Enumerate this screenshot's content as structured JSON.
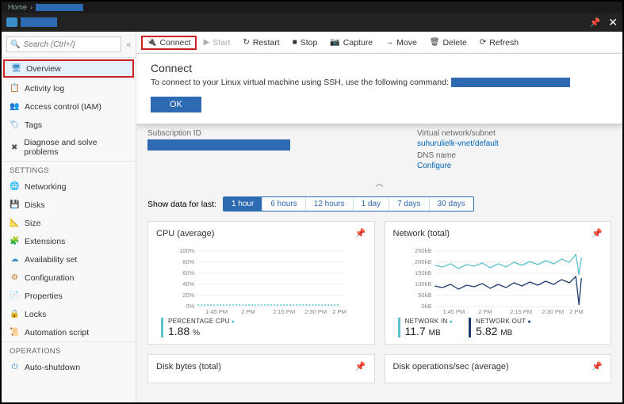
{
  "breadcrumb": {
    "home": "Home"
  },
  "search": {
    "placeholder": "Search (Ctrl+/)"
  },
  "sidebar": {
    "items": [
      {
        "label": "Overview",
        "icon": "🖥",
        "color": "#3a8dc8",
        "selected": true
      },
      {
        "label": "Activity log",
        "icon": "📋",
        "color": "#3a8dc8"
      },
      {
        "label": "Access control (IAM)",
        "icon": "👥",
        "color": "#3a8dc8"
      },
      {
        "label": "Tags",
        "icon": "🏷",
        "color": "#3a8dc8"
      },
      {
        "label": "Diagnose and solve problems",
        "icon": "✖",
        "color": "#555"
      }
    ],
    "headers": {
      "settings": "SETTINGS",
      "operations": "OPERATIONS"
    },
    "settings": [
      {
        "label": "Networking",
        "icon": "🌐",
        "color": "#e8a33d"
      },
      {
        "label": "Disks",
        "icon": "💾",
        "color": "#3a8dc8"
      },
      {
        "label": "Size",
        "icon": "📐",
        "color": "#3a8dc8"
      },
      {
        "label": "Extensions",
        "icon": "🧩",
        "color": "#3a8dc8"
      },
      {
        "label": "Availability set",
        "icon": "☁",
        "color": "#3a8dc8"
      },
      {
        "label": "Configuration",
        "icon": "⚙",
        "color": "#c97a2e"
      },
      {
        "label": "Properties",
        "icon": "📄",
        "color": "#3a8dc8"
      },
      {
        "label": "Locks",
        "icon": "🔒",
        "color": "#555"
      },
      {
        "label": "Automation script",
        "icon": "📜",
        "color": "#3a8dc8"
      }
    ],
    "operations": [
      {
        "label": "Auto-shutdown",
        "icon": "⏻",
        "color": "#3a8dc8"
      }
    ]
  },
  "toolbar": {
    "connect": "Connect",
    "start": "Start",
    "restart": "Restart",
    "stop": "Stop",
    "capture": "Capture",
    "move": "Move",
    "delete": "Delete",
    "refresh": "Refresh"
  },
  "connect_panel": {
    "title": "Connect",
    "text": "To connect to your Linux virtual machine using SSH, use the following command:",
    "ok": "OK"
  },
  "info": {
    "subid_label": "Subscription ID",
    "vnet_label": "Virtual network/subnet",
    "vnet_value": "suhurulielk-vnet/default",
    "dns_label": "DNS name",
    "dns_value": "Configure"
  },
  "range": {
    "label": "Show data for last:",
    "options": [
      "1 hour",
      "6 hours",
      "12 hours",
      "1 day",
      "7 days",
      "30 days"
    ],
    "active": 0
  },
  "charts": {
    "cpu": {
      "title": "CPU (average)",
      "metric_label": "PERCENTAGE CPU",
      "metric_value": "1.88",
      "metric_unit": "%",
      "color": "#5bc2d0"
    },
    "net": {
      "title": "Network (total)",
      "in_label": "NETWORK IN",
      "in_value": "11.7",
      "in_unit": "MB",
      "in_color": "#5bc2d0",
      "out_label": "NETWORK OUT",
      "out_value": "5.82",
      "out_unit": "MB",
      "out_color": "#1f3a6e"
    },
    "disk_bytes": {
      "title": "Disk bytes (total)"
    },
    "disk_ops": {
      "title": "Disk operations/sec (average)"
    },
    "xticks": [
      "1:45 PM",
      "2 PM",
      "2:15 PM",
      "2:30 PM",
      "2 PM"
    ]
  },
  "chart_data": [
    {
      "type": "line",
      "title": "CPU (average)",
      "xlabel": "",
      "ylabel": "",
      "ylim": [
        0,
        100
      ],
      "yticks": [
        0,
        20,
        40,
        60,
        80,
        100
      ],
      "x": [
        "1:45 PM",
        "2 PM",
        "2:15 PM",
        "2:30 PM"
      ],
      "series": [
        {
          "name": "Percentage CPU",
          "values": [
            2,
            2,
            2,
            2
          ],
          "color": "#5bc2d0"
        }
      ]
    },
    {
      "type": "line",
      "title": "Network (total)",
      "xlabel": "",
      "ylabel": "",
      "ylim": [
        0,
        250
      ],
      "yticks": [
        0,
        50,
        100,
        150,
        200,
        250
      ],
      "y_unit": "kB",
      "x": [
        "1:45 PM",
        "2 PM",
        "2:15 PM",
        "2:30 PM"
      ],
      "series": [
        {
          "name": "Network In",
          "values": [
            185,
            175,
            190,
            200
          ],
          "color": "#5bc2d0"
        },
        {
          "name": "Network Out",
          "values": [
            95,
            90,
            100,
            105
          ],
          "color": "#1f3a6e"
        }
      ]
    },
    {
      "type": "line",
      "title": "Disk bytes (total)",
      "series": []
    },
    {
      "type": "line",
      "title": "Disk operations/sec (average)",
      "series": []
    }
  ]
}
